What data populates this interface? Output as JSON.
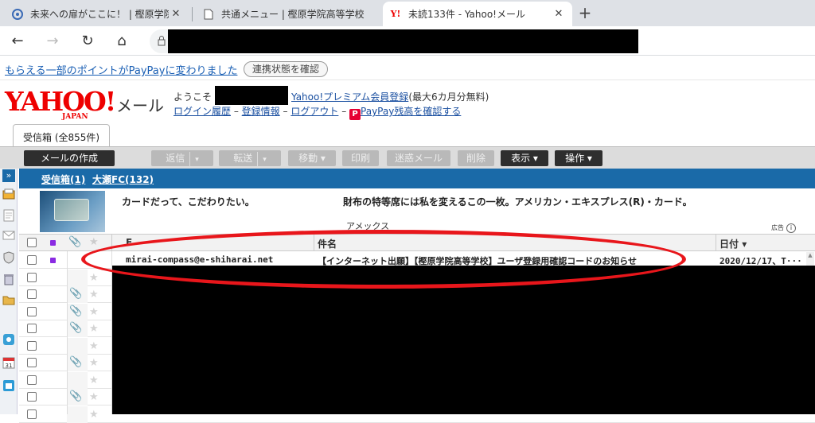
{
  "browser": {
    "tabs": [
      {
        "title": "未来への扉がここに！ | 樫原学院高",
        "icon": "edge-icon"
      },
      {
        "title": "共通メニュー | 樫原学院高等学校",
        "icon": "page-icon"
      },
      {
        "title": "未読133件 - Yahoo!メール",
        "icon": "yahoo-icon"
      }
    ],
    "close_glyph": "✕",
    "newtab_glyph": "+",
    "nav": {
      "back": "←",
      "forward": "→",
      "reload": "↻",
      "home": "⌂",
      "lock": "🔒"
    }
  },
  "promo": {
    "link": "もらえる一部のポイントがPayPayに変わりました",
    "button": "連携状態を確認"
  },
  "header": {
    "logo": "YAHOO!",
    "logo_sub": "JAPAN",
    "service": "メール",
    "welcome_prefix": "ようこそ",
    "premium_link": "Yahoo!プレミアム会員登録",
    "premium_note": "(最大6カ月分無料)",
    "login_link": "ログイン履歴",
    "sep1": "–",
    "reg_link": "登録情報",
    "sep2": "–",
    "logout_link": "ログアウト",
    "sep3": "–",
    "pay_icon": "P",
    "paypay_link": "PayPay残高を確認する"
  },
  "inbox_tab": "受信箱 (全855件)",
  "actions": {
    "compose": "メールの作成",
    "reply": "返信",
    "forward": "転送",
    "move": "移動",
    "print": "印刷",
    "spam": "迷惑メール",
    "delete": "削除",
    "view": "表示",
    "operate": "操作",
    "caret": "▾"
  },
  "left_icons": [
    "expand-icon",
    "inbox-icon",
    "draft-icon",
    "sent-icon",
    "shield-icon",
    "trash-icon",
    "folder-icon",
    "contacts-icon",
    "calendar-icon",
    "notepad-icon"
  ],
  "folders": {
    "inbox": "受信箱(1)",
    "other": "大瀬FC(132)"
  },
  "ad": {
    "text1": "カードだって、こだわりたい。",
    "text2": "財布の特等席には私を変えるこの一枚。アメリカン・エキスプレス(R)・カード。",
    "sponsor": "アメックス",
    "label": "広告",
    "info_icon": "i"
  },
  "columns": {
    "from": "F",
    "subject": "件名",
    "date": "日付",
    "sort": "▾"
  },
  "messages": [
    {
      "from": "mirai-compass@e-shiharai.net",
      "subject": "【インターネット出願】【樫原学院高等学校】ユーザ登録用確認コードのお知らせ",
      "date": "2020/12/17、T···",
      "unread": true,
      "clip": false
    },
    {
      "clip": false
    },
    {
      "clip": true
    },
    {
      "clip": true
    },
    {
      "clip": true
    },
    {
      "clip": false
    },
    {
      "clip": true
    },
    {
      "clip": false
    },
    {
      "clip": true
    },
    {
      "clip": false
    }
  ],
  "glyphs": {
    "star": "★",
    "clip": "📎",
    "scroll_up": "▲"
  }
}
